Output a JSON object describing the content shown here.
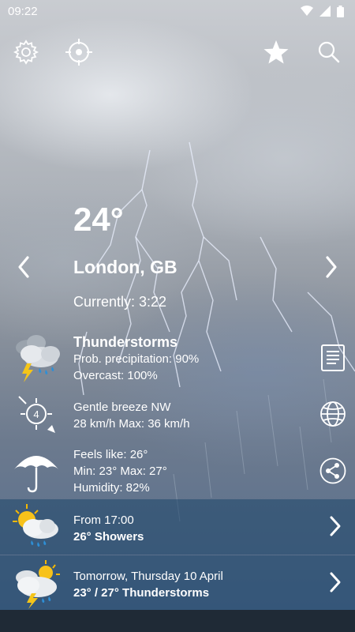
{
  "status_bar": {
    "time": "09:22"
  },
  "top_bar": {
    "settings_icon": "gear-icon",
    "locate_icon": "crosshair-icon",
    "favorite_icon": "star-icon",
    "search_icon": "search-icon"
  },
  "current": {
    "temperature": "24°",
    "location": "London, GB",
    "currently": "Currently: 3:22"
  },
  "conditions": {
    "title": "Thunderstorms",
    "precipitation": "Prob. precipitation: 90%",
    "overcast": "Overcast: 100%"
  },
  "wind": {
    "beaufort": "4",
    "description": "Gentle breeze NW",
    "speed": "28 km/h Max: 36 km/h"
  },
  "details": {
    "feels_like": "Feels like: 26°",
    "min_max": "Min: 23° Max: 27°",
    "humidity": "Humidity: 82%"
  },
  "forecast_rows": [
    {
      "line1": "From 17:00",
      "line2": "26° Showers",
      "icon": "sun-cloud-rain-icon"
    },
    {
      "line1": "Tomorrow, Thursday 10 April",
      "line2": "23° / 27° Thunderstorms",
      "icon": "sun-cloud-thunder-icon"
    }
  ],
  "side_actions": {
    "report_icon": "document-icon",
    "map_icon": "globe-icon",
    "share_icon": "share-icon"
  },
  "colors": {
    "row_background": "#1e4669",
    "text": "#ffffff"
  }
}
